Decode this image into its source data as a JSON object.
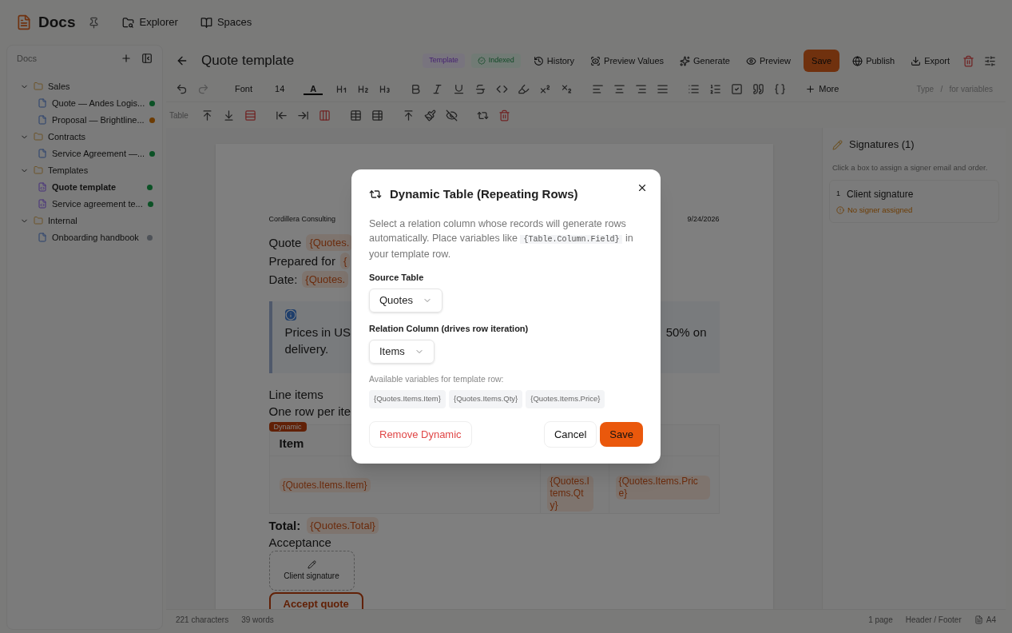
{
  "app": {
    "name": "Docs",
    "nav": [
      {
        "label": "Explorer",
        "kind": "explorer"
      },
      {
        "label": "Spaces",
        "kind": "spaces"
      }
    ]
  },
  "sidebar": {
    "title": "Docs",
    "tree": [
      {
        "label": "Sales",
        "expanded": true,
        "children": [
          {
            "label": "Quote — Andes Logis...",
            "kind": "doc",
            "selected": false,
            "color": "#0b5125"
          },
          {
            "label": "Proposal — Brightline...",
            "kind": "doc",
            "selected": false,
            "color": "#6c3b03"
          }
        ]
      },
      {
        "label": "Contracts",
        "expanded": true,
        "children": [
          {
            "label": "Service Agreement —...",
            "kind": "doc",
            "selected": false,
            "color": "#0b5125"
          }
        ]
      },
      {
        "label": "Templates",
        "expanded": true,
        "children": [
          {
            "label": "Quote template",
            "kind": "template",
            "selected": true,
            "color": "#0b5125"
          },
          {
            "label": "Service agreement te...",
            "kind": "template",
            "selected": false,
            "color": "#0b5125"
          }
        ]
      },
      {
        "label": "Internal",
        "expanded": true,
        "children": [
          {
            "label": "Onboarding handbook",
            "kind": "doc",
            "selected": false,
            "color": "#4e5258"
          }
        ]
      }
    ]
  },
  "editor": {
    "title": "Quote template",
    "badges": [
      {
        "label": "Template",
        "kind": "template"
      },
      {
        "label": "Indexed",
        "kind": "indexed"
      }
    ],
    "actions": [
      {
        "label": "History",
        "kind": "history"
      },
      {
        "label": "Preview Values",
        "kind": "preview-values"
      },
      {
        "label": "Generate",
        "kind": "generate"
      },
      {
        "label": "Preview",
        "kind": "preview"
      },
      {
        "label": "Save",
        "kind": "primary"
      },
      {
        "label": "Publish",
        "kind": "publish"
      },
      {
        "label": "Export",
        "kind": "export"
      }
    ],
    "format_bar": {
      "font": "Font",
      "size": "14",
      "color_letter": "A",
      "more": "More",
      "hint_prefix": "Type",
      "hint_key": "/",
      "hint_suffix": "for variables"
    },
    "table_bar": {
      "label": "Table"
    }
  },
  "document": {
    "company": "Cordillera Consulting",
    "date": "9/24/2026",
    "lines": [
      {
        "label": "Quote",
        "variable": "{Quotes."
      },
      {
        "label": "Prepared for",
        "variable": "{"
      },
      {
        "label": "Date:",
        "variable": "{Quotes."
      }
    ],
    "callout": {
      "left": "Prices in US",
      "right": "50% on",
      "line2": "delivery."
    },
    "section": "Line items",
    "section_note": "One row per ite",
    "dynamic_badge": "Dynamic",
    "table": {
      "column_1": "Item",
      "row": [
        "{Quotes.Items.Item}",
        "{Quotes.Items.Qty}",
        "{Quotes.Items.Price}"
      ]
    },
    "total_label": "Total:",
    "total_variable": "{Quotes.Total}",
    "acceptance": "Acceptance",
    "signature": "Client signature",
    "accept_button": "Accept quote"
  },
  "signatures": {
    "title": "Signatures (1)",
    "hint": "Click a box to assign a signer email and order.",
    "items": [
      {
        "number": "1",
        "name": "Client signature",
        "status": "No signer assigned"
      }
    ]
  },
  "status_bar": {
    "characters": "221 characters",
    "words": "39 words",
    "pages": "1 page",
    "header_footer": "Header / Footer",
    "paper": "A4"
  },
  "dialog": {
    "title": "Dynamic Table (Repeating Rows)",
    "description": "Select a relation column whose records will generate rows automatically. Place variables like",
    "code": "{Table.Column.Field}",
    "description_end": "in your template row.",
    "fields": [
      {
        "label": "Source Table",
        "value": "Quotes"
      },
      {
        "label": "Relation Column (drives row iteration)",
        "value": "Items"
      }
    ],
    "variables_label": "Available variables for template row:",
    "variables": [
      "{Quotes.Items.Item}",
      "{Quotes.Items.Qty}",
      "{Quotes.Items.Price}"
    ],
    "buttons": [
      {
        "label": "Remove Dynamic",
        "kind": "danger"
      },
      {
        "label": "Cancel",
        "kind": "secondary"
      },
      {
        "label": "Save",
        "kind": "primary"
      }
    ]
  }
}
